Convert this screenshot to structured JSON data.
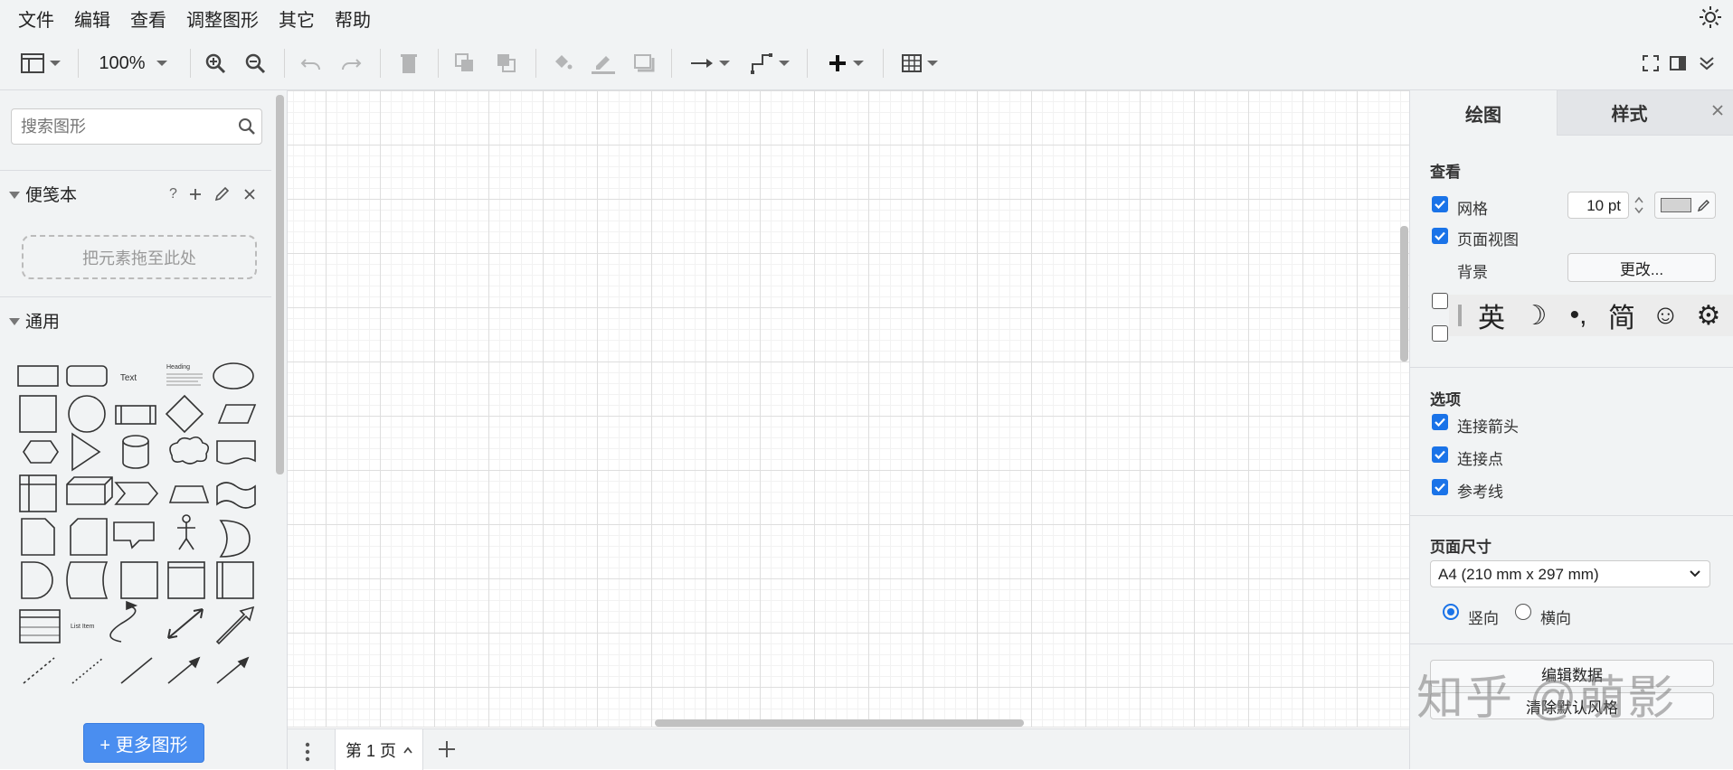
{
  "menu": [
    "文件",
    "编辑",
    "查看",
    "调整图形",
    "其它",
    "帮助"
  ],
  "toolbar": {
    "zoom": "100%"
  },
  "sidebar": {
    "search_placeholder": "搜索图形",
    "scratchpad_title": "便笺本",
    "scratchpad_help": "?",
    "drop_hint": "把元素拖至此处",
    "general_title": "通用",
    "shape_text_label": "Text",
    "shape_heading_label": "Heading",
    "shape_list_label": "List Item",
    "more_shapes": "+ 更多图形"
  },
  "pagebar": {
    "page_tab": "第 1 页"
  },
  "format": {
    "tabs": [
      "绘图",
      "样式"
    ],
    "view_heading": "查看",
    "grid_label": "网格",
    "grid_size": "10 pt",
    "grid_color": "#d3d3d3",
    "page_view_label": "页面视图",
    "background_label": "背景",
    "change_button": "更改...",
    "options_heading": "选项",
    "connection_arrows": "连接箭头",
    "connection_points": "连接点",
    "guides": "参考线",
    "paper_heading": "页面尺寸",
    "paper_size": "A4 (210 mm x 297 mm)",
    "portrait": "竖向",
    "landscape": "横向",
    "edit_data": "编辑数据",
    "clear_default_style": "清除默认风格"
  },
  "ime": {
    "keys": [
      "英",
      "☽",
      "•,",
      "简",
      "☺",
      "⚙"
    ]
  },
  "watermark": "知乎 @萌影",
  "colors": {
    "accent": "#1a73e8",
    "more_button": "#4a8ef0"
  }
}
